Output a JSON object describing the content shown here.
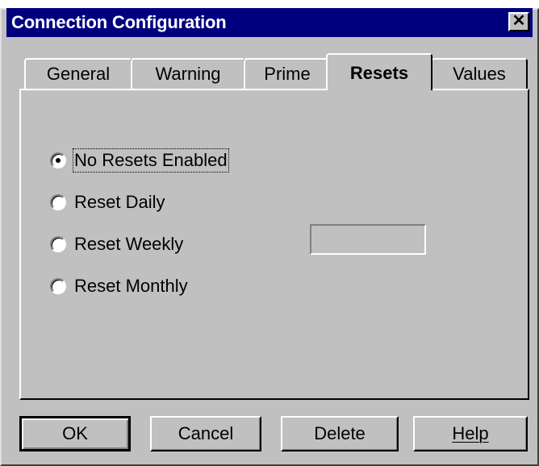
{
  "window": {
    "title": "Connection Configuration",
    "close_label": "✕"
  },
  "tabs": [
    {
      "label": "General",
      "active": false
    },
    {
      "label": "Warning",
      "active": false
    },
    {
      "label": "Prime",
      "active": false
    },
    {
      "label": "Resets",
      "active": true
    },
    {
      "label": "Values",
      "active": false
    }
  ],
  "resets": {
    "options": [
      {
        "label": "No Resets Enabled",
        "checked": true
      },
      {
        "label": "Reset Daily",
        "checked": false
      },
      {
        "label": "Reset Weekly",
        "checked": false
      },
      {
        "label": "Reset Monthly",
        "checked": false
      }
    ],
    "field_value": ""
  },
  "buttons": {
    "ok": "OK",
    "cancel": "Cancel",
    "delete": "Delete",
    "help": "Help"
  }
}
